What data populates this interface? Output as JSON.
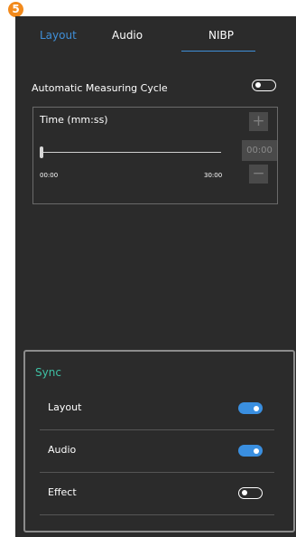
{
  "step_badge": "5",
  "tabs": [
    {
      "label": "Layout",
      "active": false
    },
    {
      "label": "Audio",
      "active": false
    },
    {
      "label": "NIBP",
      "active": true
    }
  ],
  "colors": {
    "accent_blue": "#3f8fd8",
    "sync_green": "#3ec0a4",
    "panel_bg": "#2b2b2b",
    "badge_orange": "#f28a1c"
  },
  "auto_cycle": {
    "label": "Automatic Measuring Cycle",
    "enabled": false
  },
  "time": {
    "label": "Time (mm:ss)",
    "value": "00:00",
    "plus_label": "+",
    "minus_label": "−",
    "slider_min": "00:00",
    "slider_max": "30:00",
    "slider_fraction": 0
  },
  "sync": {
    "title": "Sync",
    "items": [
      {
        "label": "Layout",
        "enabled": true
      },
      {
        "label": "Audio",
        "enabled": true
      },
      {
        "label": "Effect",
        "enabled": false
      }
    ]
  }
}
